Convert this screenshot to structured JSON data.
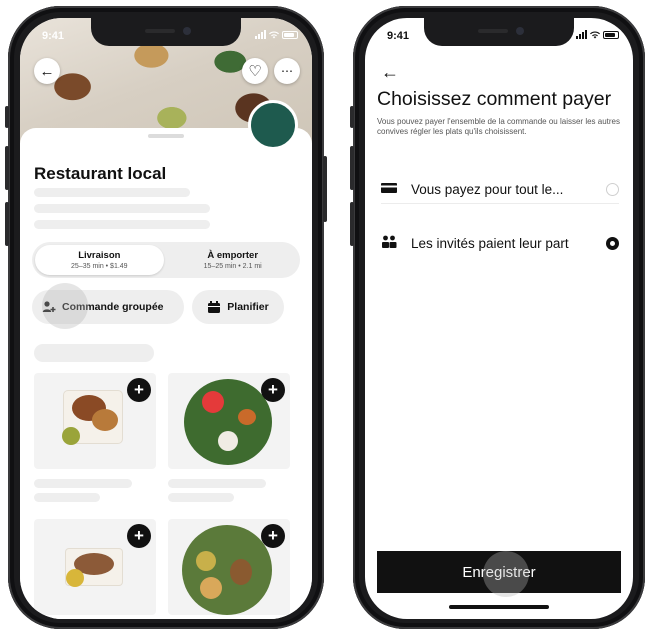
{
  "left": {
    "status_time": "9:41",
    "restaurant_title": "Restaurant local",
    "tabs": {
      "delivery_label": "Livraison",
      "delivery_sub": "25–35 min • $1.49",
      "pickup_label": "À emporter",
      "pickup_sub": "15–25 min • 2.1 mi"
    },
    "group_order_label": "Commande groupée",
    "schedule_label": "Planifier",
    "icons": {
      "back": "arrow-left-icon",
      "favorite": "heart-icon",
      "more": "more-icon",
      "group": "group-person-icon",
      "calendar": "calendar-icon",
      "add": "plus-icon"
    },
    "colors": {
      "brand_logo": "#1e5a4e"
    }
  },
  "right": {
    "status_time": "9:41",
    "title": "Choisissez comment payer",
    "description": "Vous pouvez payer l'ensemble de la commande ou laisser les autres convives régler les plats qu'ils choisissent.",
    "options": [
      {
        "label": "Vous payez pour tout le...",
        "icon": "card-icon",
        "selected": false
      },
      {
        "label": "Les invités paient leur part",
        "icon": "group-icon",
        "selected": true
      }
    ],
    "save_label": "Enregistrer"
  }
}
